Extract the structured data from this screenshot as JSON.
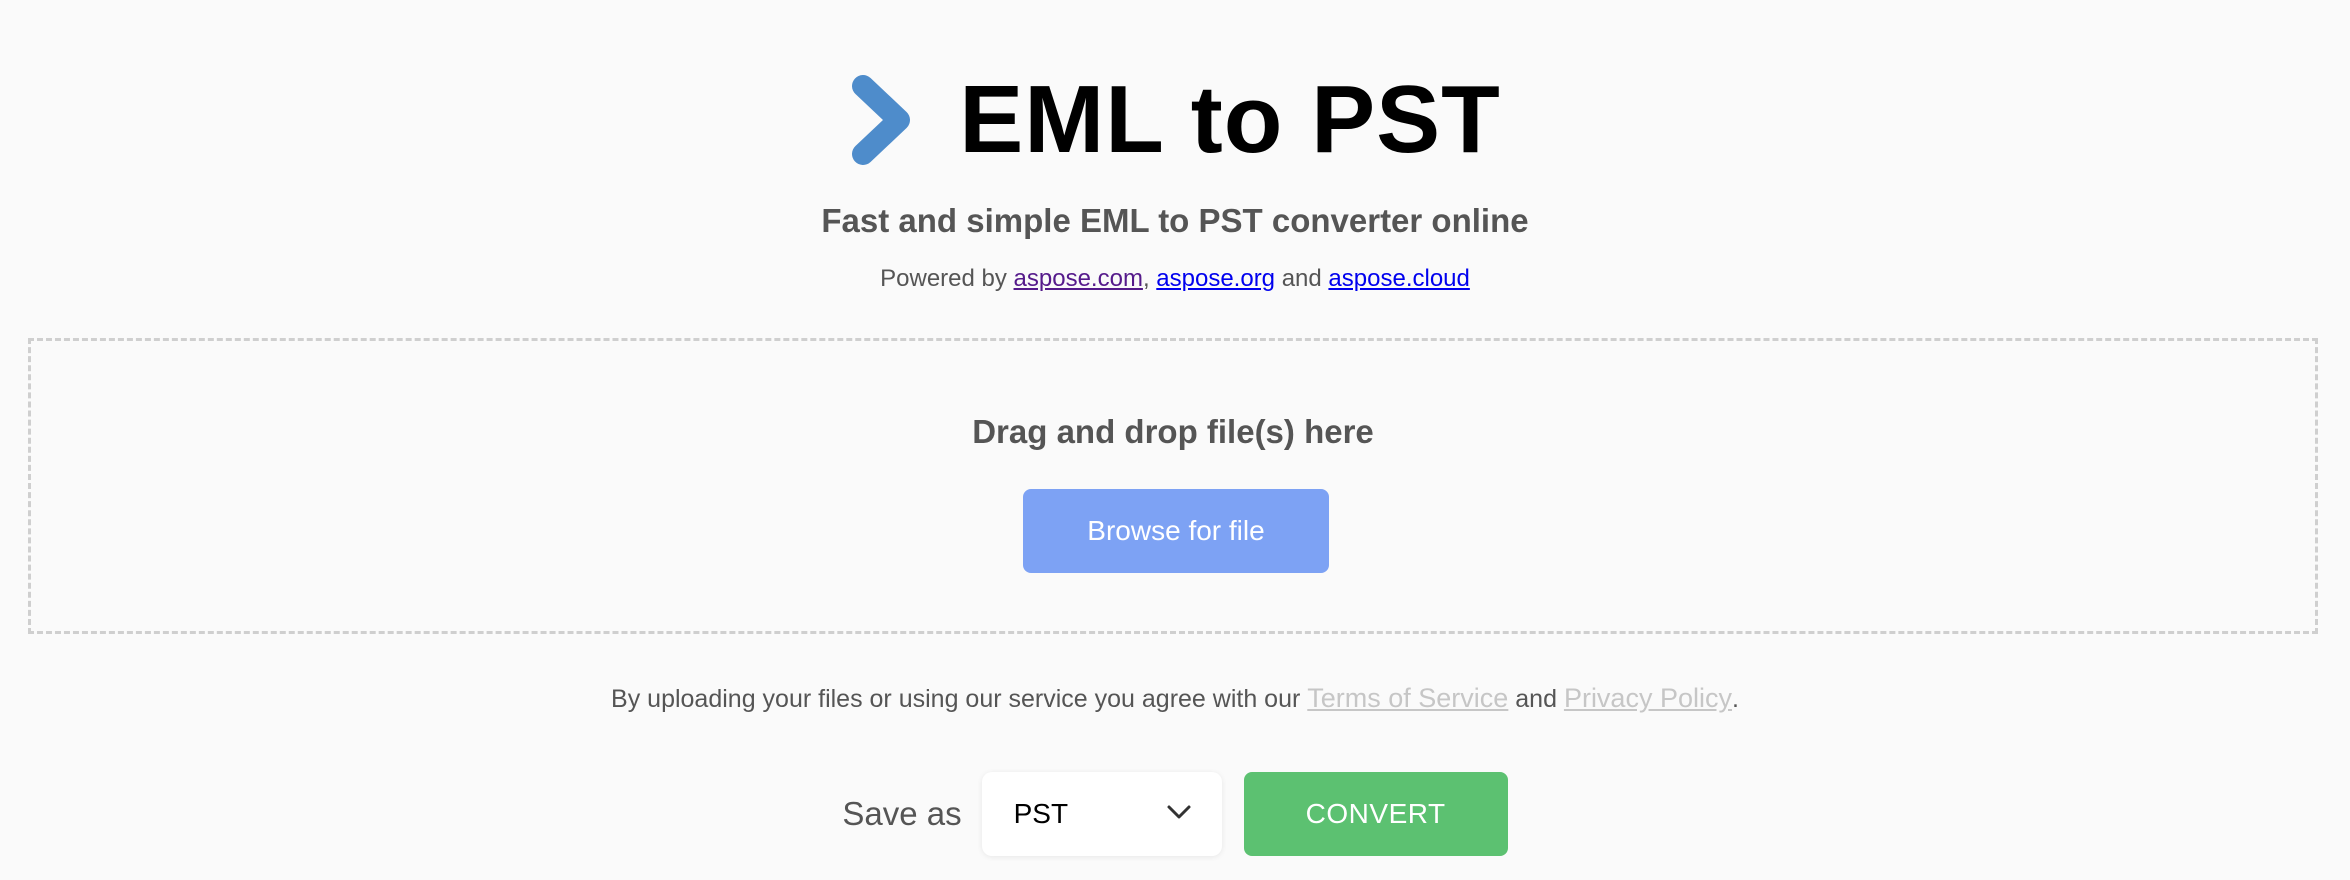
{
  "header": {
    "title": "EML to PST",
    "logo_icon": "chevron-right-icon",
    "logo_color": "#4e8ccb"
  },
  "subtitle": "Fast and simple EML to PST converter online",
  "powered": {
    "prefix": "Powered by ",
    "link1": "aspose.com",
    "sep1": ", ",
    "link2": "aspose.org",
    "sep2": " and ",
    "link3": "aspose.cloud"
  },
  "dropzone": {
    "text": "Drag and drop file(s) here",
    "browse_label": "Browse for file",
    "button_color": "#7da2f4"
  },
  "terms": {
    "prefix": "By uploading your files or using our service you agree with our ",
    "tos": "Terms of Service",
    "and": " and ",
    "privacy": "Privacy Policy",
    "suffix": "."
  },
  "save": {
    "label": "Save as",
    "selected_format": "PST",
    "convert_label": "CONVERT",
    "convert_color": "#5cc171"
  }
}
